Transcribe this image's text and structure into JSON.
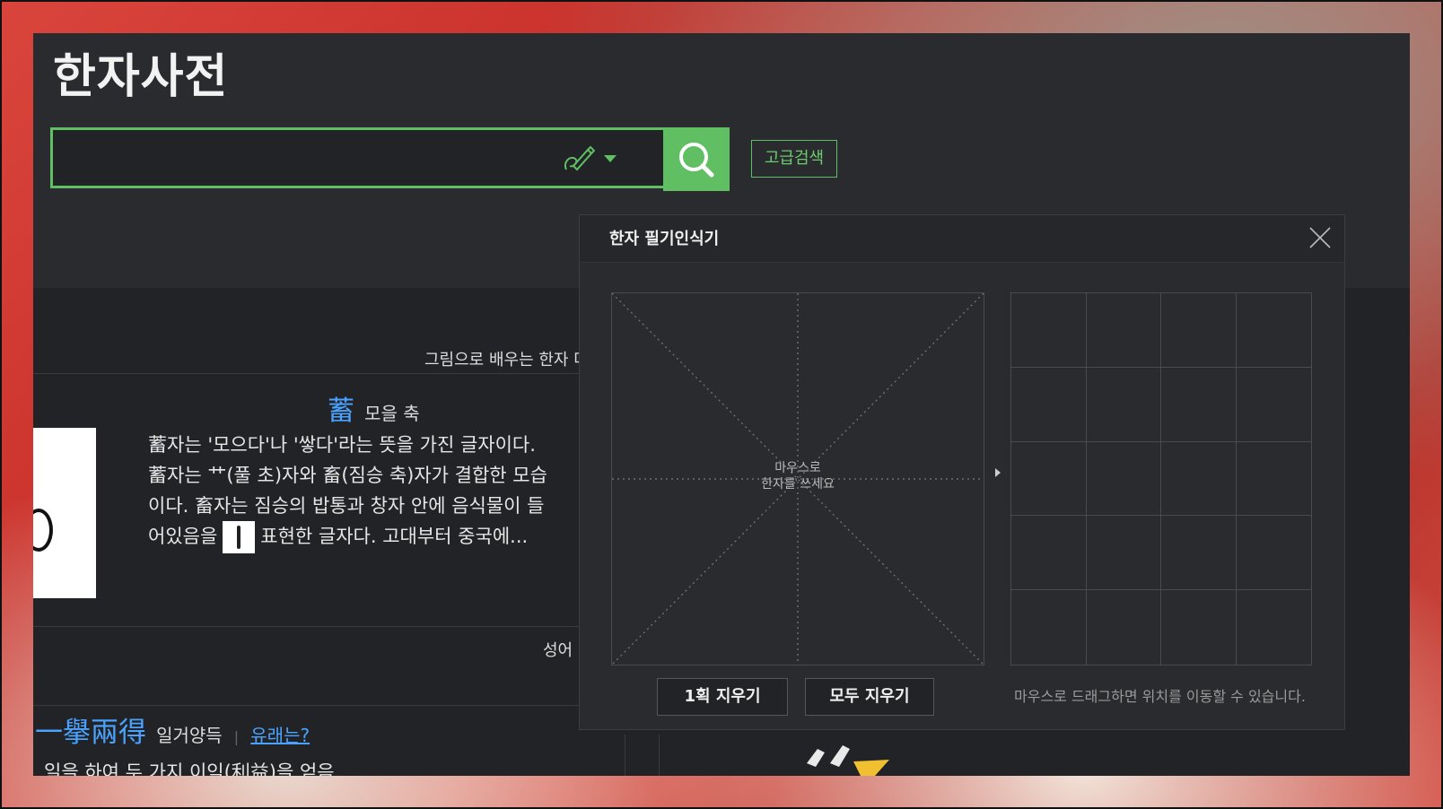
{
  "header": {
    "logo": "한자사전",
    "search_placeholder": "",
    "advanced_search": "고급검색"
  },
  "content": {
    "section1_title": "그림으로 배우는 한자 다",
    "hanja": {
      "char": "蓄",
      "reading": "모을 축"
    },
    "description_lines": [
      "蓄자는 '모으다'나 '쌓다'라는 뜻을 가진 글자이다.",
      "蓄자는 艹(풀 초)자와 畜(짐승 축)자가 결합한 모습",
      "이다. 畜자는 짐승의 밥통과 창자 안에 음식물이 들",
      "어있음을",
      "표현한 글자다. 고대부터 중국에..."
    ],
    "section2_title": "성어 다",
    "idiom": {
      "chars": "一擧兩得",
      "reading": "일거양득",
      "separator": "|",
      "link": "유래는?"
    },
    "idiom_desc": "일을 하여 두 가지 이익(利益)을 얻음"
  },
  "panel": {
    "title": "한자 필기인식기",
    "canvas_hint_line1": "마우스로",
    "canvas_hint_line2": "한자를 쓰세요",
    "undo_stroke": "1획 지우기",
    "clear_all": "모두 지우기",
    "drag_hint": "마우스로 드래그하면 위치를 이동할 수 있습니다."
  },
  "colors": {
    "accent_green": "#5fbf62",
    "link_blue": "#4aa3ff",
    "background_dark": "#222327"
  }
}
